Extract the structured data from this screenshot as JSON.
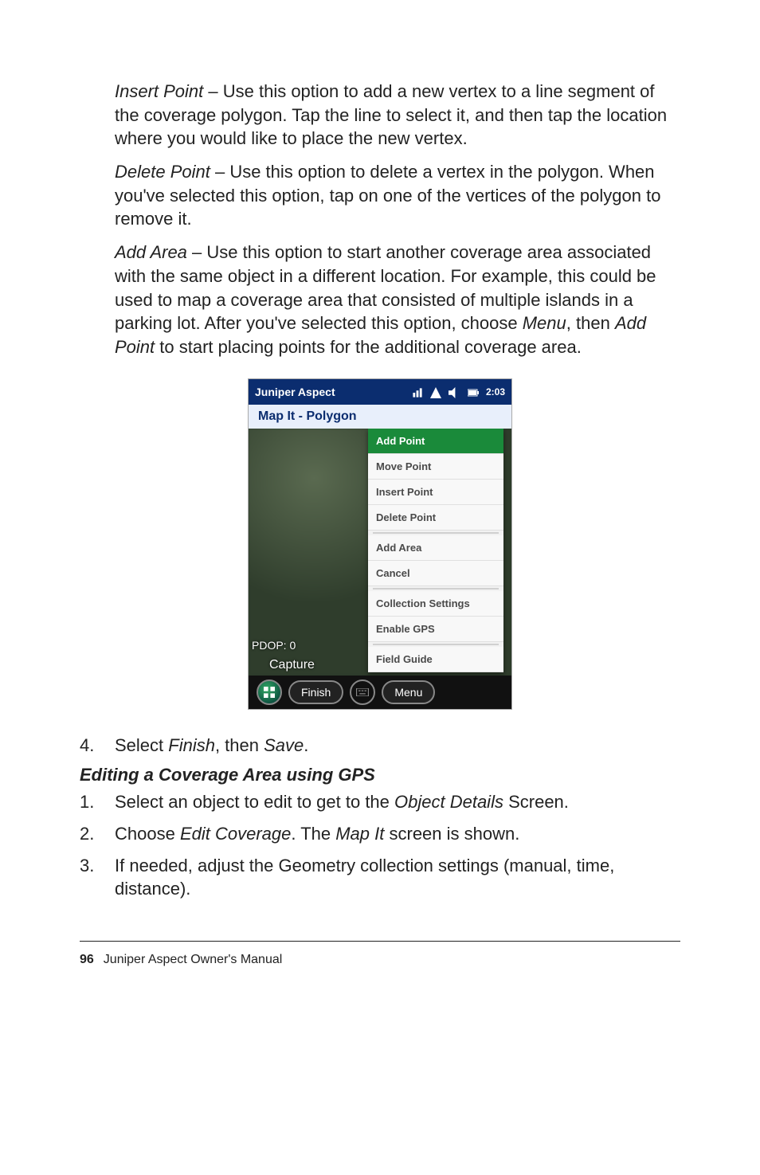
{
  "paragraphs": {
    "insert_point": {
      "label": "Insert Point",
      "text": " – Use this option to add a new vertex to a line segment of the coverage polygon. Tap the line to select it, and then tap the location where you would like to place the new vertex."
    },
    "delete_point": {
      "label": "Delete Point",
      "text": " – Use this option to delete a vertex in the polygon. When you've selected this option, tap on one of the vertices of the polygon to remove it."
    },
    "add_area": {
      "label": "Add Area",
      "text_before": " – Use this option to start another coverage area associated with the same object in a different location. For example, this could be used to map a coverage area that consisted of multiple islands in a parking lot.  After you've selected this option, choose ",
      "menu_word": "Menu",
      "text_mid": ", then ",
      "add_point_word": "Add Point",
      "text_after": " to start placing points for the additional coverage area."
    }
  },
  "screenshot": {
    "title": "Juniper Aspect",
    "time": "2:03",
    "header": "Map It - Polygon",
    "menu": [
      "Add Point",
      "Move Point",
      "Insert Point",
      "Delete Point",
      "Add Area",
      "Cancel",
      "Collection Settings",
      "Enable GPS",
      "Field Guide"
    ],
    "selected_index": 0,
    "pdop": "PDOP: 0",
    "capture": "Capture",
    "finish": "Finish",
    "menu_btn": "Menu"
  },
  "step4": {
    "num": "4.",
    "prefix": "Select ",
    "finish": "Finish",
    "mid": ", then ",
    "save": "Save",
    "suffix": "."
  },
  "heading": "Editing a Coverage Area using GPS",
  "steps": [
    {
      "num": "1.",
      "html_parts": {
        "pre": "Select an object to edit to get to the ",
        "em": "Object Details",
        "post": " Screen."
      }
    },
    {
      "num": "2.",
      "html_parts": {
        "pre": "Choose ",
        "em": "Edit Coverage",
        "mid": ". The ",
        "em2": "Map It",
        "post": " screen is shown."
      }
    },
    {
      "num": "3.",
      "html_parts": {
        "pre": "If needed, adjust the Geometry collection settings (manual, time, distance).",
        "em": "",
        "post": ""
      }
    }
  ],
  "footer": {
    "page": "96",
    "title": "Juniper Aspect Owner's Manual"
  }
}
